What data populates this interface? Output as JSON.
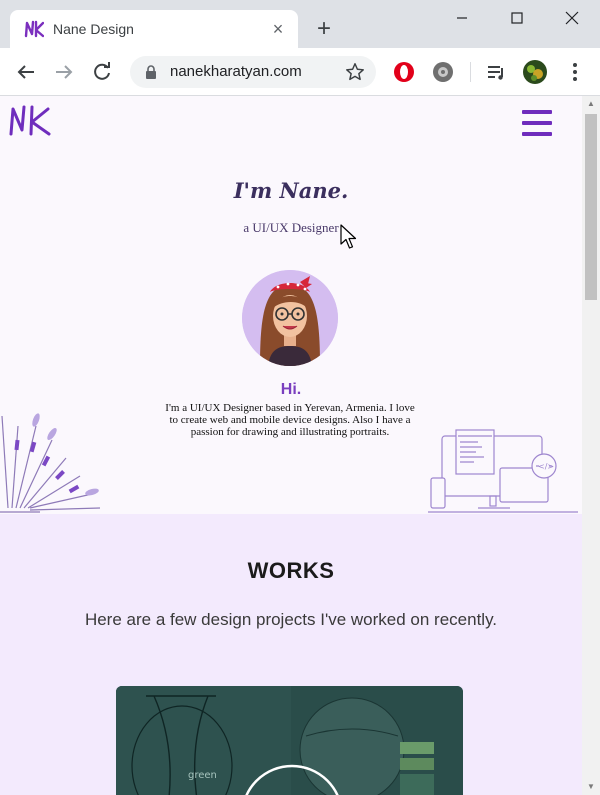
{
  "browser": {
    "tab_title": "Nane Design",
    "url": "nanekharatyan.com",
    "tab_close_glyph": "×",
    "new_tab_glyph": "+"
  },
  "site": {
    "logo_text": "NK",
    "hero": {
      "title": "I'm Nane.",
      "subtitle": "a UI/UX Designer",
      "greeting": "Hi.",
      "bio": "I'm a UI/UX Designer based in Yerevan, Armenia. I love to create web and mobile device designs. Also I have a passion for drawing and illustrating portraits."
    },
    "works": {
      "title": "WORKS",
      "description": "Here are a few design projects I've worked on recently."
    }
  },
  "colors": {
    "brand": "#6f2dbd",
    "hero_bg": "#fbf8fd",
    "works_bg": "#f3eafd",
    "card_bg": "#2a4d4a"
  },
  "icons": [
    "favicon-icon",
    "close-icon",
    "plus-icon",
    "minimize-icon",
    "maximize-icon",
    "window-close-icon",
    "back-icon",
    "forward-icon",
    "reload-icon",
    "lock-icon",
    "star-icon",
    "opera-extension-icon",
    "gear-extension-icon",
    "media-control-icon",
    "profile-avatar-icon",
    "menu-icon",
    "hamburger-icon",
    "cursor-icon"
  ]
}
